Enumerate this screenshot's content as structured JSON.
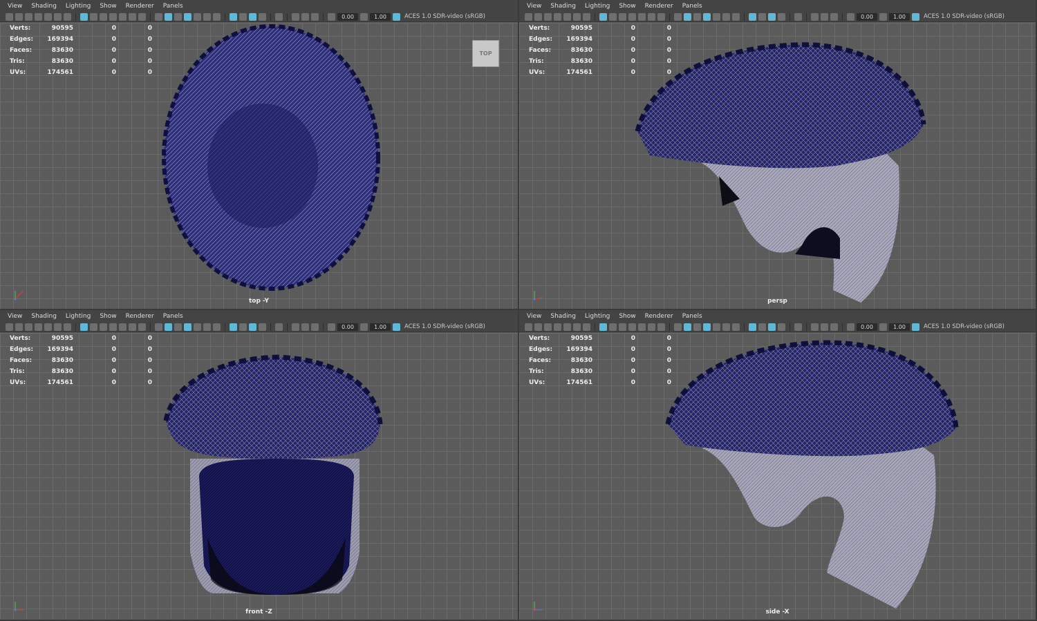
{
  "menu": [
    "View",
    "Shading",
    "Lighting",
    "Show",
    "Renderer",
    "Panels"
  ],
  "toolbar": {
    "exposure_value": "0.00",
    "gamma_value": "1.00",
    "colorspace_label": "ACES 1.0 SDR-video (sRGB)"
  },
  "hud": {
    "rows": [
      {
        "label": "Verts:",
        "value": "90595",
        "sel": "0",
        "comp": "0"
      },
      {
        "label": "Edges:",
        "value": "169394",
        "sel": "0",
        "comp": "0"
      },
      {
        "label": "Faces:",
        "value": "83630",
        "sel": "0",
        "comp": "0"
      },
      {
        "label": "Tris:",
        "value": "83630",
        "sel": "0",
        "comp": "0"
      },
      {
        "label": "UVs:",
        "value": "174561",
        "sel": "0",
        "comp": "0"
      }
    ]
  },
  "viewports": [
    {
      "camera": "top -Y",
      "viewcube": "TOP"
    },
    {
      "camera": "persp"
    },
    {
      "camera": "front -Z"
    },
    {
      "camera": "side -X"
    }
  ],
  "colors": {
    "mesh_dark": "#11114a",
    "mesh_mid": "#3a3a86",
    "mesh_light": "#9a9aa8",
    "accent": "#5fb8d6"
  }
}
